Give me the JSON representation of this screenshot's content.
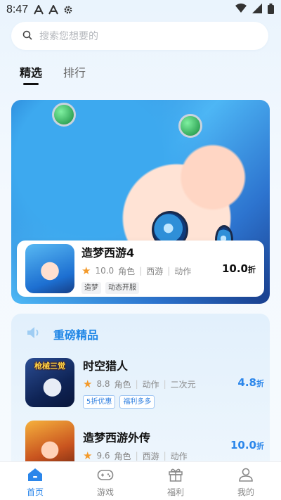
{
  "status_bar": {
    "time": "8:47"
  },
  "search": {
    "placeholder": "搜索您想要的"
  },
  "tabs": [
    {
      "label": "精选",
      "active": true
    },
    {
      "label": "排行",
      "active": false
    }
  ],
  "banner_game": {
    "title": "造梦西游4",
    "rating": "10.0",
    "genres": [
      "角色",
      "西游",
      "动作"
    ],
    "tags": [
      "造梦",
      "动态开服"
    ],
    "discount_value": "10.0",
    "discount_unit": "折"
  },
  "section": {
    "title": "重磅精品",
    "games": [
      {
        "title": "时空猎人",
        "icon_text": "枪械三觉",
        "rating": "8.8",
        "genres": [
          "角色",
          "动作",
          "二次元"
        ],
        "tags": [
          "5折优惠",
          "福利多多"
        ],
        "discount_value": "4.8",
        "discount_unit": "折"
      },
      {
        "title": "造梦西游外传",
        "rating": "9.6",
        "genres": [
          "角色",
          "西游",
          "动作"
        ],
        "discount_value": "10.0",
        "discount_unit": "折"
      }
    ]
  },
  "tabbar": [
    {
      "label": "首页",
      "icon": "home-icon",
      "active": true
    },
    {
      "label": "游戏",
      "icon": "gamepad-icon",
      "active": false
    },
    {
      "label": "福利",
      "icon": "gift-icon",
      "active": false
    },
    {
      "label": "我的",
      "icon": "user-icon",
      "active": false
    }
  ],
  "colors": {
    "accent": "#2b86ea",
    "star": "#f39a2b"
  }
}
